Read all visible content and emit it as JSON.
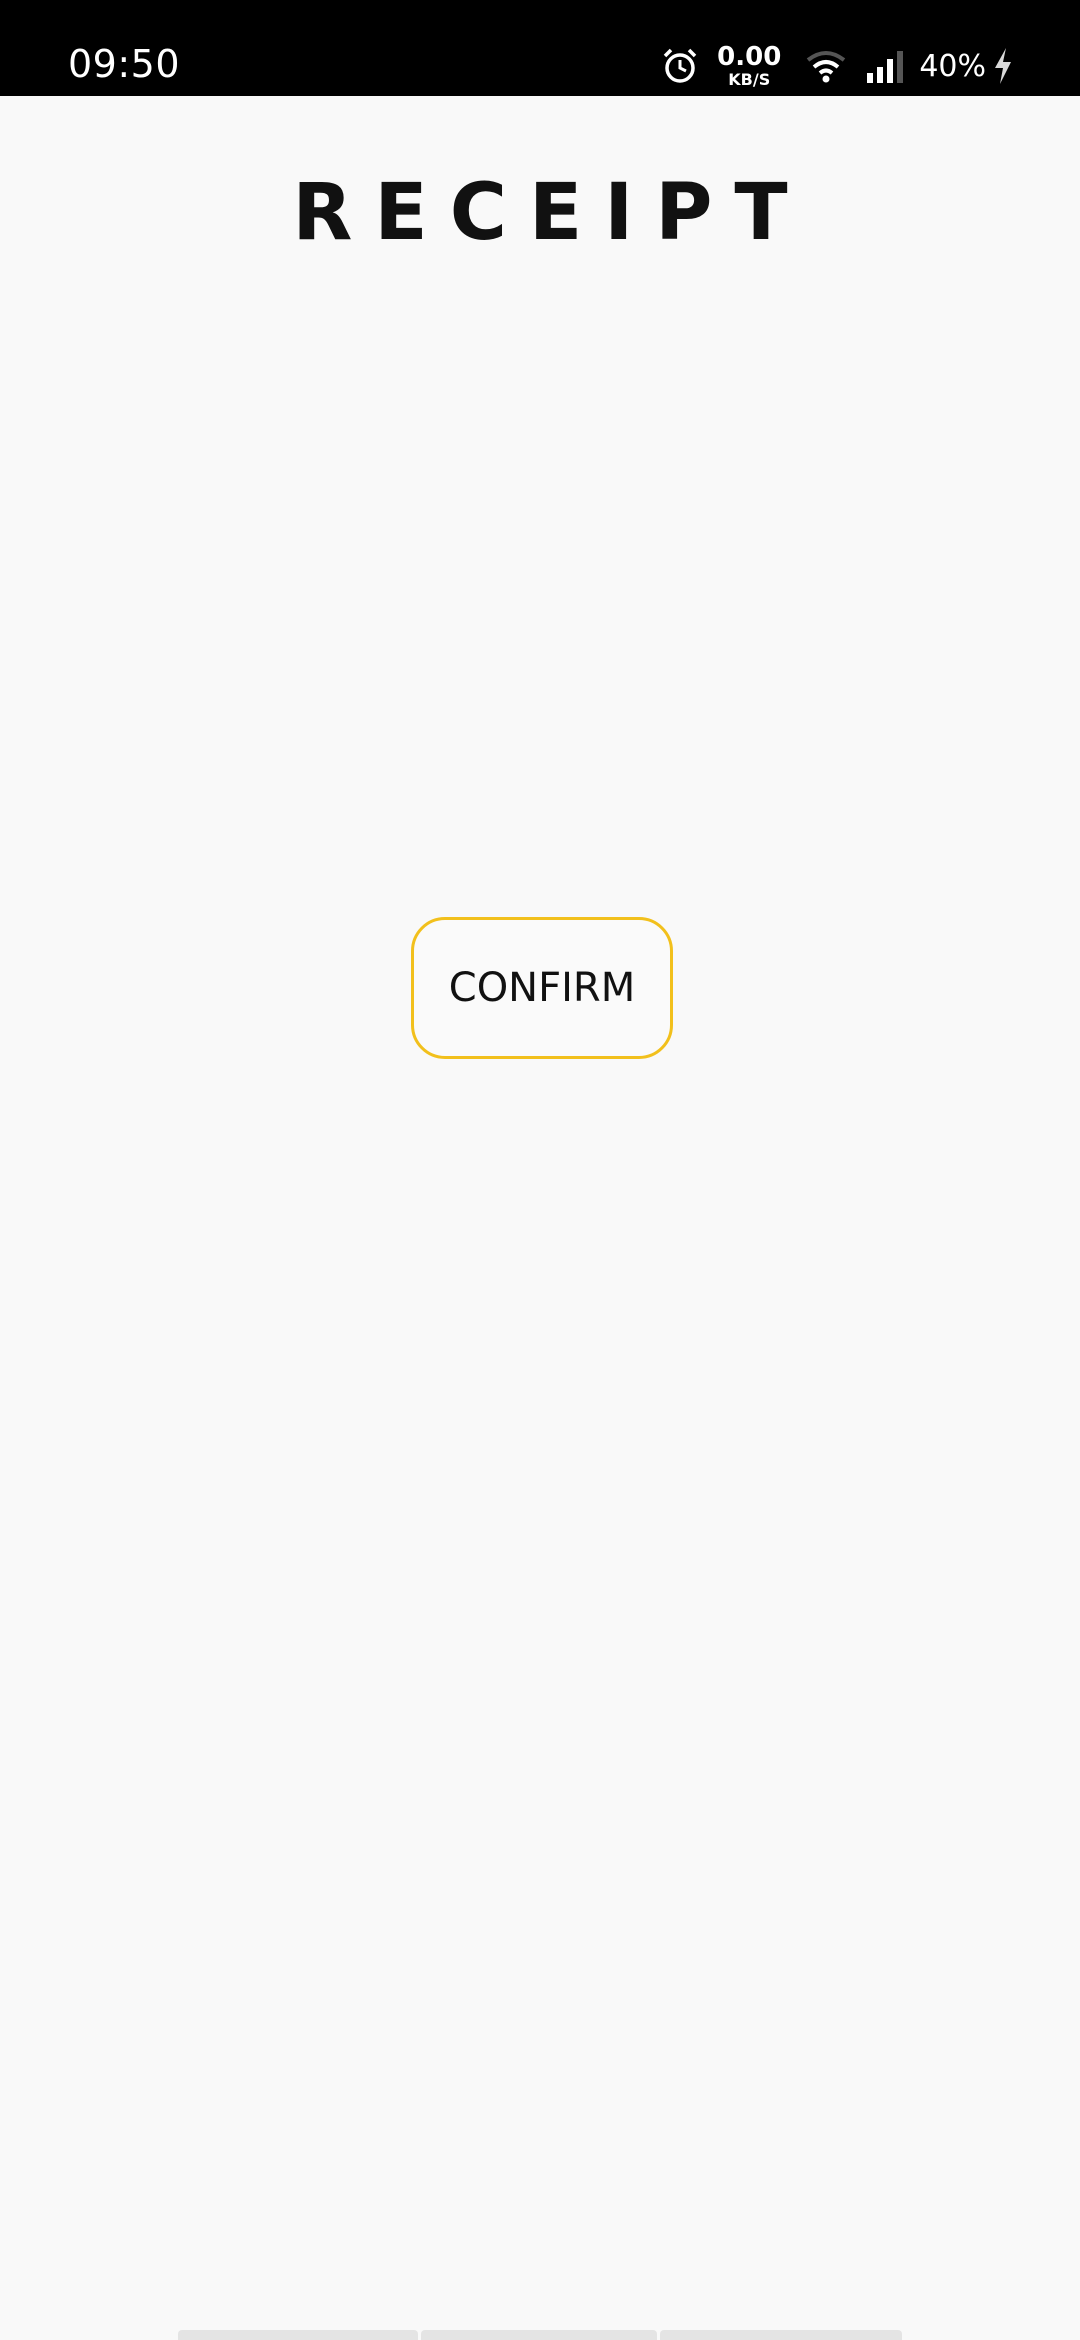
{
  "status_bar": {
    "time": "09:50",
    "net_speed_value": "0.00",
    "net_speed_unit": "KB/S",
    "battery": "40%",
    "icons": [
      "alarm-icon",
      "wifi-icon",
      "signal-icon",
      "charging-icon"
    ]
  },
  "page": {
    "title": "RECEIPT"
  },
  "actions": {
    "confirm_label": "CONFIRM"
  },
  "colors": {
    "accent": "#f2c01c",
    "background": "#f9f9f9",
    "status_bar": "#000000"
  }
}
